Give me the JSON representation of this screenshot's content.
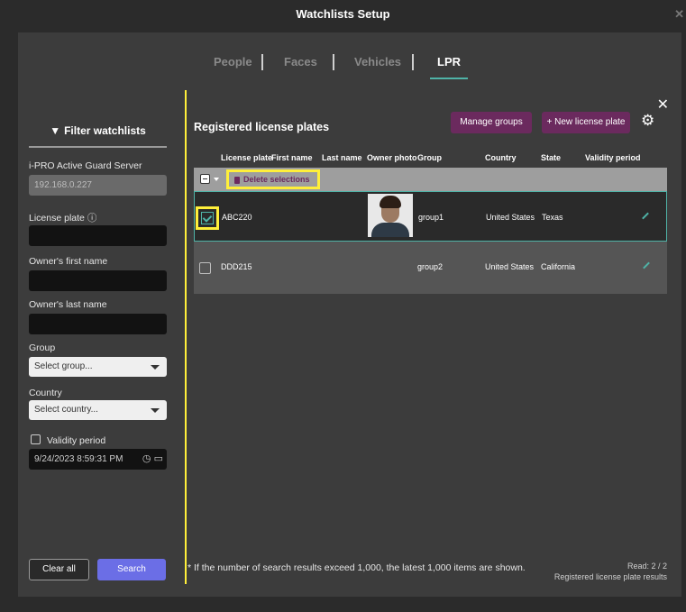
{
  "window": {
    "title": "Watchlists Setup"
  },
  "tabs": [
    {
      "label": "People",
      "active": false
    },
    {
      "label": "Faces",
      "active": false
    },
    {
      "label": "Vehicles",
      "active": false
    },
    {
      "label": "LPR",
      "active": true
    }
  ],
  "filter": {
    "title": "Filter watchlists",
    "server_label": "i-PRO Active Guard Server",
    "server_value": "192.168.0.227",
    "license_plate_label": "License plate",
    "license_plate_value": "",
    "first_name_label": "Owner's first name",
    "first_name_value": "",
    "last_name_label": "Owner's last name",
    "last_name_value": "",
    "group_label": "Group",
    "group_placeholder": "Select group...",
    "country_label": "Country",
    "country_placeholder": "Select country...",
    "validity_label": "Validity period",
    "validity_checked": false,
    "validity_value": "9/24/2023 8:59:31 PM",
    "clear_label": "Clear all",
    "search_label": "Search"
  },
  "main": {
    "title": "Registered license plates",
    "manage_groups_label": "Manage groups",
    "new_plate_label": "+ New license plate",
    "delete_selections_label": "Delete selections",
    "columns": [
      "License plate",
      "First name",
      "Last name",
      "Owner photo",
      "Group",
      "Country",
      "State",
      "Validity period"
    ],
    "rows": [
      {
        "checked": true,
        "plate": "ABC220",
        "first": "",
        "last": "",
        "has_photo": true,
        "group": "group1",
        "country": "United States",
        "state": "Texas",
        "validity": ""
      },
      {
        "checked": false,
        "plate": "DDD215",
        "first": "",
        "last": "",
        "has_photo": false,
        "group": "group2",
        "country": "United States",
        "state": "California",
        "validity": ""
      }
    ],
    "footnote": "* If the number of search results exceed 1,000, the latest 1,000 items are shown.",
    "read_count": "Read: 2 / 2",
    "read_caption": "Registered license plate results"
  },
  "colors": {
    "accent_teal": "#4fb3a7",
    "purple_button": "#6b2a5e",
    "search_button": "#6b6ee6",
    "highlight_yellow": "#ffef3a"
  }
}
